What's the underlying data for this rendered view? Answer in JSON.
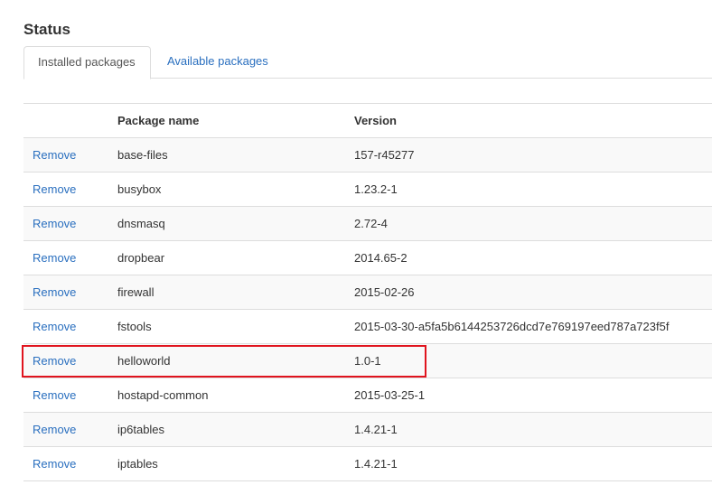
{
  "page": {
    "title": "Status"
  },
  "tabs": [
    {
      "label": "Installed packages",
      "active": true
    },
    {
      "label": "Available packages",
      "active": false
    }
  ],
  "table": {
    "columns": [
      "",
      "Package name",
      "Version"
    ],
    "action_label": "Remove",
    "rows": [
      {
        "name": "base-files",
        "version": "157-r45277"
      },
      {
        "name": "busybox",
        "version": "1.23.2-1"
      },
      {
        "name": "dnsmasq",
        "version": "2.72-4"
      },
      {
        "name": "dropbear",
        "version": "2014.65-2"
      },
      {
        "name": "firewall",
        "version": "2015-02-26"
      },
      {
        "name": "fstools",
        "version": "2015-03-30-a5fa5b6144253726dcd7e769197eed787a723f5f"
      },
      {
        "name": "helloworld",
        "version": "1.0-1",
        "highlighted": true
      },
      {
        "name": "hostapd-common",
        "version": "2015-03-25-1"
      },
      {
        "name": "ip6tables",
        "version": "1.4.21-1"
      },
      {
        "name": "iptables",
        "version": "1.4.21-1"
      }
    ]
  },
  "colors": {
    "link": "#2a6fbf",
    "highlight": "#e0141e",
    "stripe": "#f9f9f9",
    "border": "#dddddd"
  }
}
